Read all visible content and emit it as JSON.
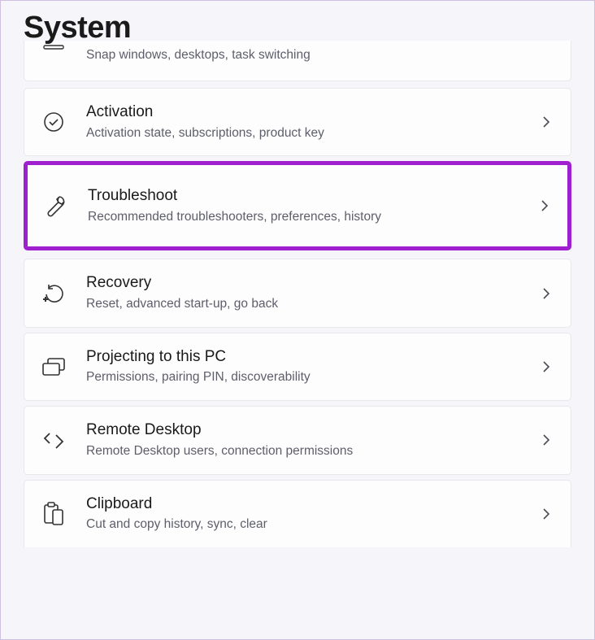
{
  "page": {
    "title": "System"
  },
  "items": [
    {
      "title": "",
      "subtitle": "Snap windows, desktops, task switching",
      "icon": "multitasking-icon"
    },
    {
      "title": "Activation",
      "subtitle": "Activation state, subscriptions, product key",
      "icon": "activation-icon"
    },
    {
      "title": "Troubleshoot",
      "subtitle": "Recommended troubleshooters, preferences, history",
      "icon": "troubleshoot-icon",
      "highlighted": true
    },
    {
      "title": "Recovery",
      "subtitle": "Reset, advanced start-up, go back",
      "icon": "recovery-icon"
    },
    {
      "title": "Projecting to this PC",
      "subtitle": "Permissions, pairing PIN, discoverability",
      "icon": "projecting-icon"
    },
    {
      "title": "Remote Desktop",
      "subtitle": "Remote Desktop users, connection permissions",
      "icon": "remote-desktop-icon"
    },
    {
      "title": "Clipboard",
      "subtitle": "Cut and copy history, sync, clear",
      "icon": "clipboard-icon"
    }
  ]
}
